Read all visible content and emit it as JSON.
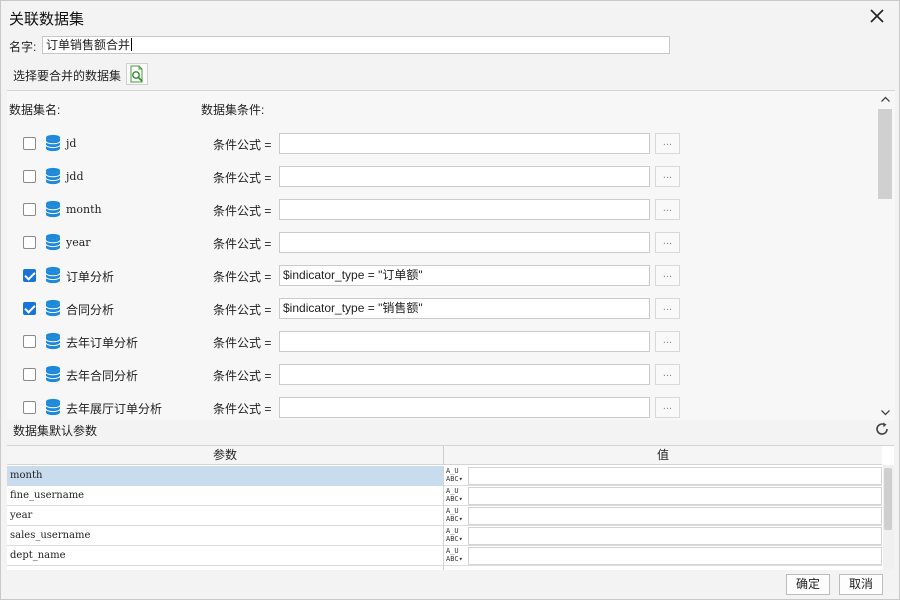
{
  "dialog": {
    "title": "关联数据集"
  },
  "name_field": {
    "label": "名字:",
    "value": "订单销售额合并"
  },
  "select_datasets": {
    "label": "选择要合并的数据集"
  },
  "columns": {
    "dataset_name": "数据集名:",
    "dataset_condition": "数据集条件:"
  },
  "cond_label": "条件公式 =",
  "ellipsis": "...",
  "datasets": [
    {
      "name": "jd",
      "checked": false,
      "formula": ""
    },
    {
      "name": "jdd",
      "checked": false,
      "formula": ""
    },
    {
      "name": "month",
      "checked": false,
      "formula": ""
    },
    {
      "name": "year",
      "checked": false,
      "formula": ""
    },
    {
      "name": "订单分析",
      "checked": true,
      "formula": "$indicator_type = \"订单额\""
    },
    {
      "name": "合同分析",
      "checked": true,
      "formula": "$indicator_type = \"销售额\""
    },
    {
      "name": "去年订单分析",
      "checked": false,
      "formula": ""
    },
    {
      "name": "去年合同分析",
      "checked": false,
      "formula": ""
    },
    {
      "name": "去年展厅订单分析",
      "checked": false,
      "formula": ""
    }
  ],
  "params": {
    "title": "数据集默认参数",
    "col_param": "参数",
    "col_value": "值",
    "type_icon": "A̲U ABC▾",
    "rows": [
      {
        "name": "month",
        "value": "",
        "selected": true
      },
      {
        "name": "fine_username",
        "value": "",
        "selected": false
      },
      {
        "name": "year",
        "value": "",
        "selected": false
      },
      {
        "name": "sales_username",
        "value": "",
        "selected": false
      },
      {
        "name": "dept_name",
        "value": "",
        "selected": false
      }
    ]
  },
  "buttons": {
    "ok": "确定",
    "cancel": "取消"
  },
  "colors": {
    "accent": "#1a73d9",
    "db_icon": "#1e88d9",
    "selected_row": "#c9dced"
  }
}
